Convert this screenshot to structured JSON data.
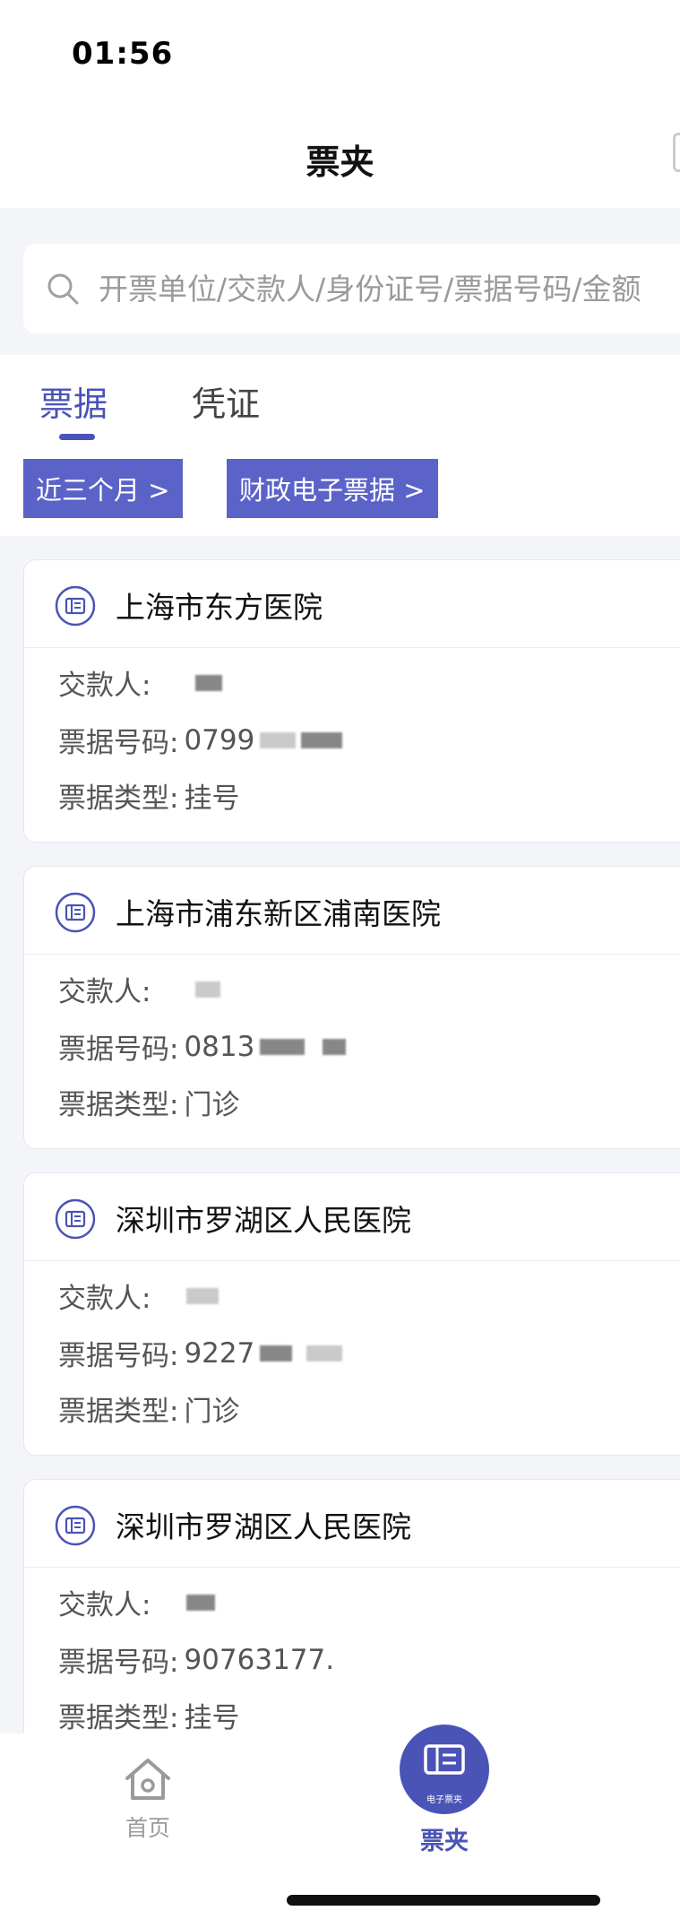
{
  "status_bar": {
    "time": "01:56"
  },
  "nav": {
    "title": "票夹"
  },
  "search": {
    "placeholder": "开票单位/交款人/身份证号/票据号码/金额"
  },
  "tabs": [
    {
      "label": "票据",
      "active": true
    },
    {
      "label": "凭证",
      "active": false
    }
  ],
  "filters": [
    {
      "label": "近三个月 >"
    },
    {
      "label": "财政电子票据 >"
    }
  ],
  "field_labels": {
    "payer": "交款人:",
    "bill_number": "票据号码:",
    "bill_type": "票据类型:"
  },
  "bills": [
    {
      "hospital": "上海市东方医院",
      "bill_number": "0799",
      "bill_type": "挂号"
    },
    {
      "hospital": "上海市浦东新区浦南医院",
      "bill_number": "0813",
      "bill_type": "门诊"
    },
    {
      "hospital": "深圳市罗湖区人民医院",
      "bill_number": "9227",
      "bill_type": "门诊"
    },
    {
      "hospital": "深圳市罗湖区人民医院",
      "bill_number": "90763177.",
      "bill_type": "挂号"
    }
  ],
  "bottom_tabs": {
    "home": {
      "label": "首页",
      "icon": "home-icon"
    },
    "wallet": {
      "label": "票夹",
      "icon": "bill-wallet-icon",
      "badge_text": "电子票夹"
    }
  },
  "colors": {
    "accent": "#4a53b6",
    "chip": "#5b63c8",
    "background": "#f4f5f9"
  }
}
